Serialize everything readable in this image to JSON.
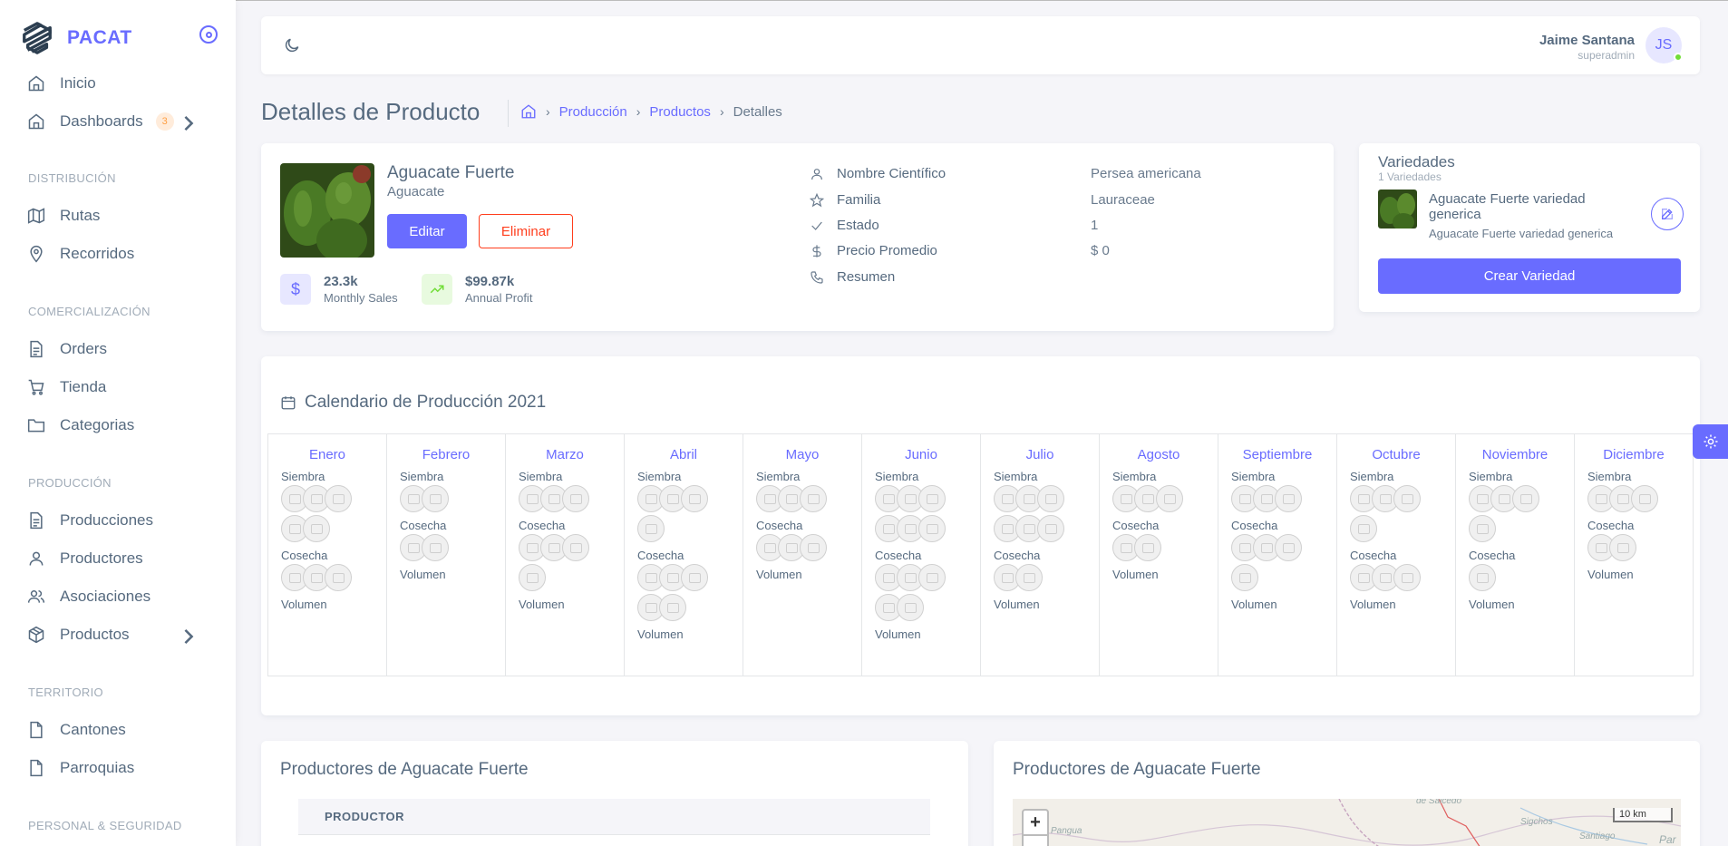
{
  "brand": {
    "name": "PACAT"
  },
  "sidebar": {
    "items_top": [
      {
        "label": "Inicio"
      },
      {
        "label": "Dashboards",
        "badge": "3"
      }
    ],
    "sections": [
      {
        "header": "DISTRIBUCIÓN",
        "items": [
          {
            "label": "Rutas"
          },
          {
            "label": "Recorridos"
          }
        ]
      },
      {
        "header": "COMERCIALIZACIÓN",
        "items": [
          {
            "label": "Orders"
          },
          {
            "label": "Tienda"
          },
          {
            "label": "Categorias"
          }
        ]
      },
      {
        "header": "PRODUCCIÓN",
        "items": [
          {
            "label": "Producciones"
          },
          {
            "label": "Productores"
          },
          {
            "label": "Asociaciones"
          },
          {
            "label": "Productos"
          }
        ]
      },
      {
        "header": "TERRITORIO",
        "items": [
          {
            "label": "Cantones"
          },
          {
            "label": "Parroquias"
          }
        ]
      },
      {
        "header": "PERSONAL & SEGURIDAD",
        "items": []
      }
    ]
  },
  "user": {
    "name": "Jaime Santana",
    "role": "superadmin",
    "initials": "JS"
  },
  "page": {
    "title": "Detalles de Producto",
    "breadcrumb": {
      "b1": "Producción",
      "b2": "Productos",
      "b3": "Detalles"
    }
  },
  "product": {
    "name": "Aguacate Fuerte",
    "type": "Aguacate",
    "edit_label": "Editar",
    "delete_label": "Eliminar",
    "stats": {
      "sales_value": "23.3k",
      "sales_label": "Monthly Sales",
      "profit_value": "$99.87k",
      "profit_label": "Annual Profit"
    },
    "info": {
      "sci_label": "Nombre Científico",
      "sci_value": "Persea americana",
      "fam_label": "Familia",
      "fam_value": "Lauraceae",
      "estado_label": "Estado",
      "estado_value": "1",
      "precio_label": "Precio Promedio",
      "precio_value": "$ 0",
      "resumen_label": "Resumen"
    }
  },
  "varieties": {
    "title": "Variedades",
    "count": "1 Variedades",
    "item_name": "Aguacate Fuerte variedad generica",
    "item_desc": "Aguacate Fuerte variedad generica",
    "create_label": "Crear Variedad"
  },
  "calendar": {
    "title": "Calendario de Producción 2021",
    "row_labels": {
      "siembra": "Siembra",
      "cosecha": "Cosecha",
      "volumen": "Volumen"
    },
    "months": [
      {
        "name": "Enero",
        "siembra": 5,
        "cosecha": 3
      },
      {
        "name": "Febrero",
        "siembra": 2,
        "cosecha": 2
      },
      {
        "name": "Marzo",
        "siembra": 3,
        "cosecha": 4
      },
      {
        "name": "Abril",
        "siembra": 4,
        "cosecha": 5
      },
      {
        "name": "Mayo",
        "siembra": 3,
        "cosecha": 3
      },
      {
        "name": "Junio",
        "siembra": 6,
        "cosecha": 5
      },
      {
        "name": "Julio",
        "siembra": 6,
        "cosecha": 2
      },
      {
        "name": "Agosto",
        "siembra": 3,
        "cosecha": 2
      },
      {
        "name": "Septiembre",
        "siembra": 3,
        "cosecha": 4
      },
      {
        "name": "Octubre",
        "siembra": 4,
        "cosecha": 3
      },
      {
        "name": "Noviembre",
        "siembra": 4,
        "cosecha": 1
      },
      {
        "name": "Diciembre",
        "siembra": 3,
        "cosecha": 2
      }
    ]
  },
  "producers": {
    "table_title": "Productores de Aguacate Fuerte",
    "column": "PRODUCTOR",
    "map_title": "Productores de Aguacate Fuerte",
    "map": {
      "zoom_in": "+",
      "scale": "10 km",
      "places": [
        "de Salcedo",
        "Sigchos",
        "Pangua",
        "Par",
        "Santiago"
      ]
    }
  }
}
